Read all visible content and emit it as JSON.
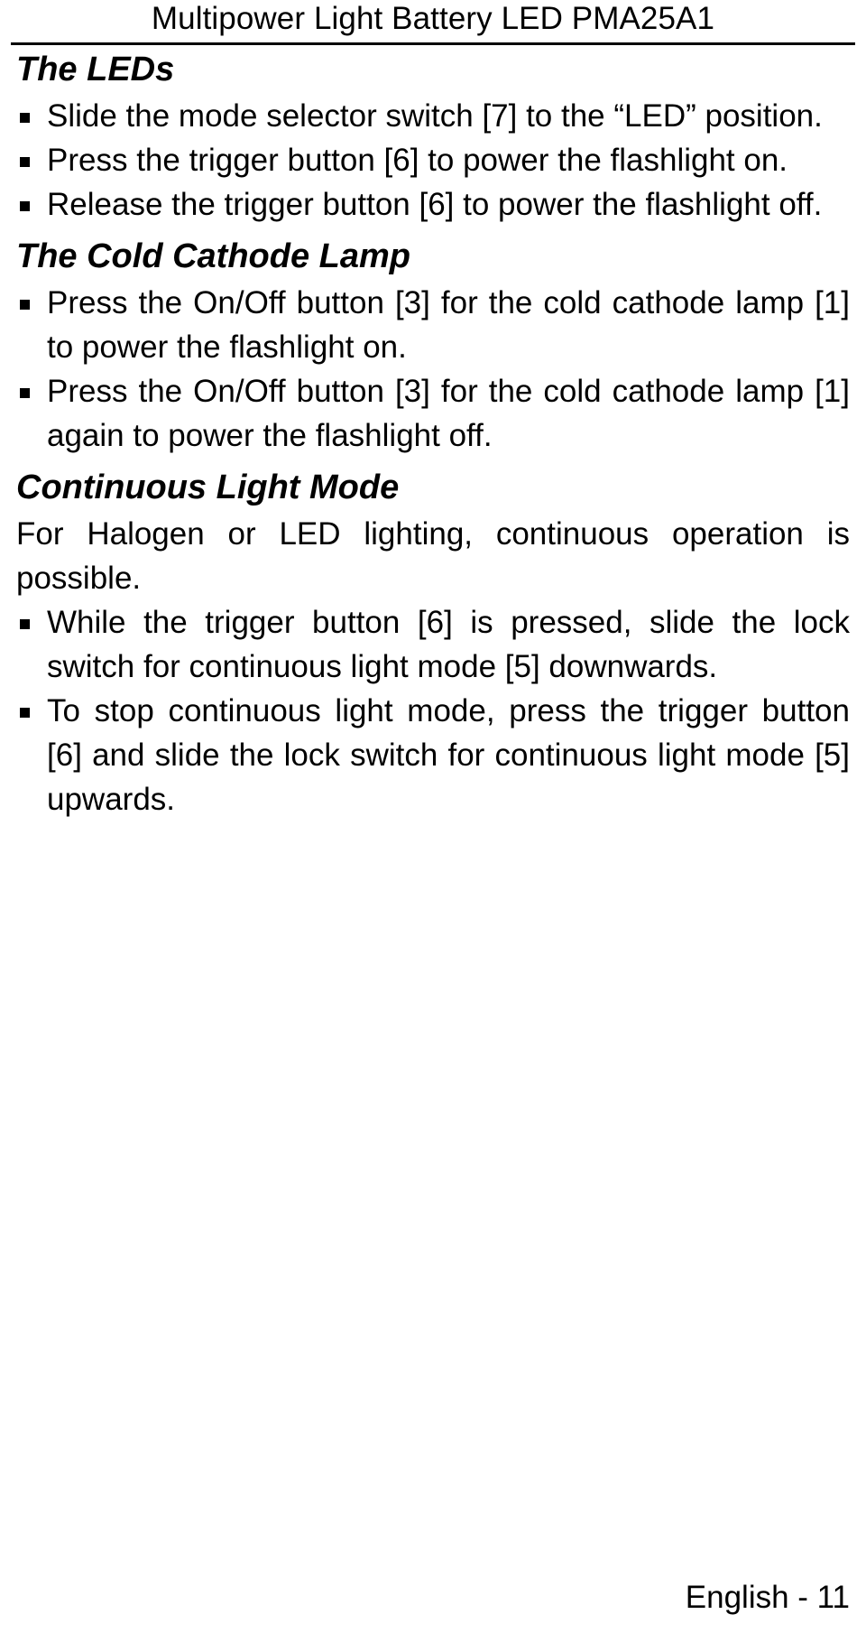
{
  "header": {
    "title": "Multipower Light Battery LED PMA25A1"
  },
  "sections": [
    {
      "heading": "The LEDs",
      "items": [
        "Slide the mode selector switch [7] to the “LED” position.",
        "Press the trigger button [6] to power the flashlight on.",
        "Release the trigger button [6] to power the flashlight off."
      ]
    },
    {
      "heading": "The Cold Cathode Lamp",
      "items": [
        "Press the On/Off button [3] for the cold cathode lamp [1] to power the flashlight on.",
        "Press the On/Off button [3] for the cold cathode lamp [1] again to power the flashlight off."
      ]
    },
    {
      "heading": "Continuous Light Mode",
      "intro": "For Halogen or LED lighting, continuous operation is possible.",
      "items": [
        "While the trigger button [6] is pressed, slide the lock switch for continuous light mode [5] downwards.",
        "To stop continuous light mode, press the trigger button [6] and slide the lock switch for continuous light mode [5] upwards."
      ]
    }
  ],
  "footer": {
    "page_label": "English - 11"
  }
}
